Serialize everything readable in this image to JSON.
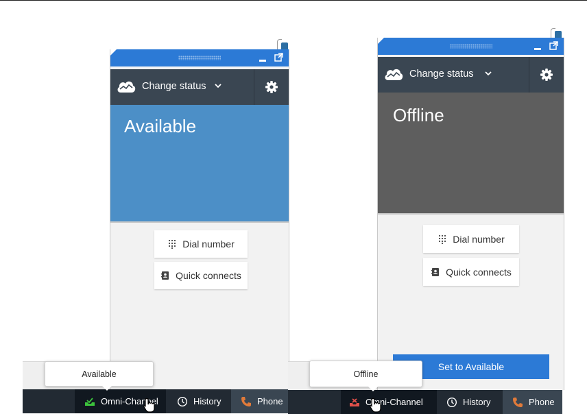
{
  "colors": {
    "title_bar": "#2c7ad6",
    "status_bar": "#3a4652",
    "available_state": "#4c8fc7",
    "offline_state": "#5e5e5e",
    "taskbar": "#222a33",
    "omni_available_icon": "#3cc43c",
    "omni_offline_icon": "#e0504a",
    "primary_button": "#2c7ad6"
  },
  "left_panel": {
    "status_menu_label": "Change status",
    "state": "Available",
    "buttons": {
      "dial": "Dial number",
      "quick": "Quick connects"
    },
    "tooltip": "Available",
    "taskbar": {
      "omni": "Omni-Channel",
      "history": "History",
      "phone": "Phone"
    }
  },
  "right_panel": {
    "status_menu_label": "Change status",
    "state": "Offline",
    "buttons": {
      "dial": "Dial number",
      "quick": "Quick connects",
      "set_available": "Set to Available"
    },
    "tooltip": "Offline",
    "taskbar": {
      "omni": "Omni-Channel",
      "history": "History",
      "phone": "Phone"
    }
  },
  "icons": [
    "cloud-icon",
    "chevron-down-icon",
    "gear-icon",
    "dialpad-icon",
    "contact-card-icon",
    "minimize-icon",
    "popout-icon",
    "inbox-icon",
    "clock-icon",
    "phone-icon",
    "hand-cursor-icon"
  ]
}
